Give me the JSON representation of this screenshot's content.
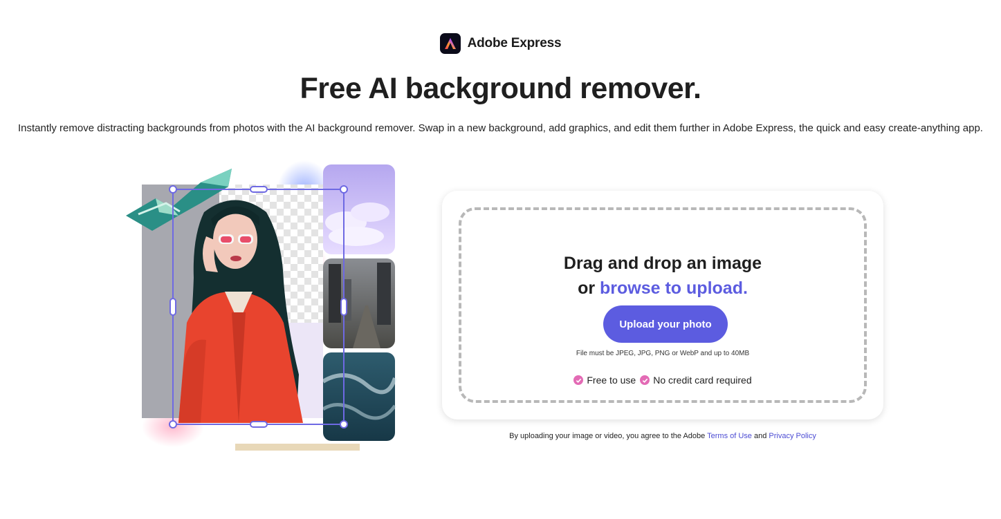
{
  "brand": {
    "name": "Adobe Express",
    "logo_icon": "adobe-express-logo",
    "logo_bg": "#0b0b1a"
  },
  "hero": {
    "title": "Free AI background remover.",
    "subtitle": "Instantly remove distracting backgrounds from photos with the AI background remover. Swap in a new background, add graphics, and edit them further in Adobe Express, the quick and easy create-anything app."
  },
  "upload": {
    "line1": "Drag and drop an image",
    "line2_prefix": "or ",
    "line2_link": "browse to upload.",
    "button_label": "Upload your photo",
    "file_note": "File must be JPEG, JPG, PNG or WebP and up to 40MB",
    "perks": [
      "Free to use",
      "No credit card required"
    ]
  },
  "legal": {
    "prefix": "By uploading your image or video, you agree to the Adobe ",
    "terms_link": "Terms of Use",
    "and": " and ",
    "privacy_link": "Privacy Policy"
  },
  "colors": {
    "accent": "#5c5ce0",
    "check": "#e36bb5",
    "jacket": "#e8442e"
  }
}
